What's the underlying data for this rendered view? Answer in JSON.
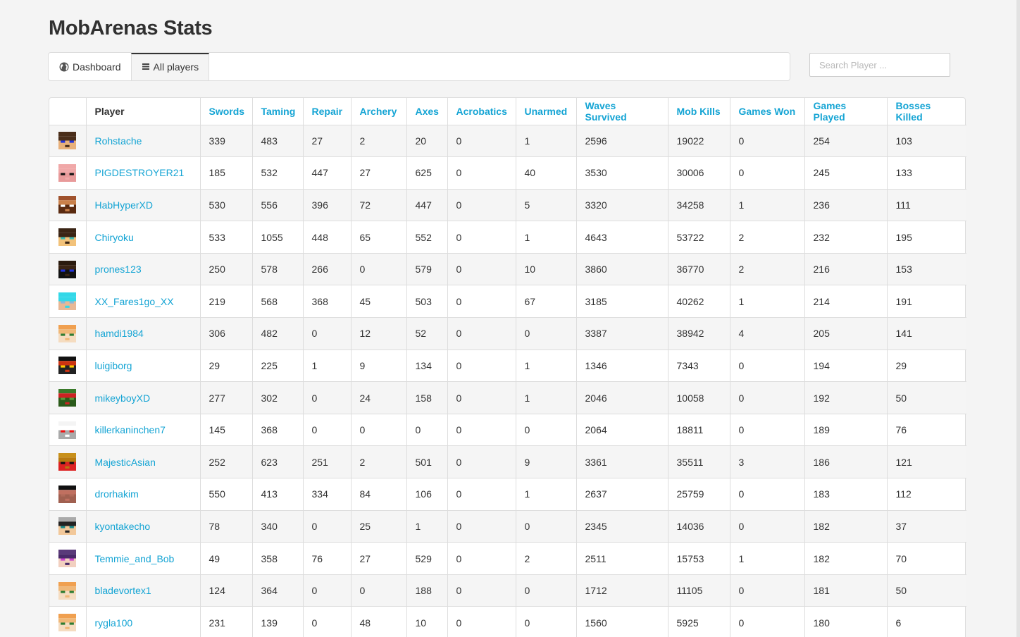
{
  "app": {
    "title": "MobArenas Stats"
  },
  "nav": {
    "items": [
      {
        "label": "Dashboard",
        "icon": "globe-icon",
        "active": false
      },
      {
        "label": "All players",
        "icon": "list-icon",
        "active": true
      }
    ]
  },
  "search": {
    "placeholder": "Search Player ...",
    "value": ""
  },
  "colors": {
    "accent": "#14a4d4",
    "text": "#333333",
    "background": "#f4f4f4",
    "stripe": "#f5f5f5"
  },
  "table": {
    "headers": [
      "",
      "Player",
      "Swords",
      "Taming",
      "Repair",
      "Archery",
      "Axes",
      "Acrobatics",
      "Unarmed",
      "Waves Survived",
      "Mob Kills",
      "Games Won",
      "Games Played",
      "Bosses Killed"
    ],
    "rows": [
      {
        "player": "Rohstache",
        "avatar": [
          "#4a2e1a",
          "#4a2e1a",
          "#2233dd",
          "#e8b07a"
        ],
        "stats": [
          "339",
          "483",
          "27",
          "2",
          "20",
          "0",
          "1",
          "2596",
          "19022",
          "0",
          "254",
          "103"
        ]
      },
      {
        "player": "PIGDESTROYER21",
        "avatar": [
          "#f0a8a8",
          "#f0a8a8",
          "#111111",
          "#e89a9a"
        ],
        "stats": [
          "185",
          "532",
          "447",
          "27",
          "625",
          "0",
          "40",
          "3530",
          "30006",
          "0",
          "245",
          "133"
        ]
      },
      {
        "player": "HabHyperXD",
        "avatar": [
          "#a0522d",
          "#c9804a",
          "#ffffff",
          "#5a2a10"
        ],
        "stats": [
          "530",
          "556",
          "396",
          "72",
          "447",
          "0",
          "5",
          "3320",
          "34258",
          "1",
          "236",
          "111"
        ]
      },
      {
        "player": "Chiryoku",
        "avatar": [
          "#3a2414",
          "#3a2414",
          "#3fb8b0",
          "#f2c27a"
        ],
        "stats": [
          "533",
          "1055",
          "448",
          "65",
          "552",
          "0",
          "1",
          "4643",
          "53722",
          "2",
          "232",
          "195"
        ]
      },
      {
        "player": "prones123",
        "avatar": [
          "#2a1a0e",
          "#3a2414",
          "#2233dd",
          "#111111"
        ],
        "stats": [
          "250",
          "578",
          "266",
          "0",
          "579",
          "0",
          "10",
          "3860",
          "36770",
          "2",
          "216",
          "153"
        ]
      },
      {
        "player": "XX_Fares1go_XX",
        "avatar": [
          "#33d8e8",
          "#33d8e8",
          "#8ab8d8",
          "#e8b895"
        ],
        "stats": [
          "219",
          "568",
          "368",
          "45",
          "503",
          "0",
          "67",
          "3185",
          "40262",
          "1",
          "214",
          "191"
        ]
      },
      {
        "player": "hamdi1984",
        "avatar": [
          "#f0a050",
          "#f0b878",
          "#2e7d32",
          "#f5dcc0"
        ],
        "stats": [
          "306",
          "482",
          "0",
          "12",
          "52",
          "0",
          "0",
          "3387",
          "38942",
          "4",
          "205",
          "141"
        ]
      },
      {
        "player": "luigiborg",
        "avatar": [
          "#111111",
          "#cc3311",
          "#ffcc00",
          "#222222"
        ],
        "stats": [
          "29",
          "225",
          "1",
          "9",
          "134",
          "0",
          "1",
          "1346",
          "7343",
          "0",
          "194",
          "29"
        ]
      },
      {
        "player": "mikeyboyXD",
        "avatar": [
          "#3a7a2a",
          "#cc2222",
          "#5a9a3a",
          "#2a5a1a"
        ],
        "stats": [
          "277",
          "302",
          "0",
          "24",
          "158",
          "0",
          "1",
          "2046",
          "10058",
          "0",
          "192",
          "50"
        ]
      },
      {
        "player": "killerkaninchen7",
        "avatar": [
          "#f4f4f4",
          "#ffffff",
          "#ee1111",
          "#aaaaaa"
        ],
        "stats": [
          "145",
          "368",
          "0",
          "0",
          "0",
          "0",
          "0",
          "2064",
          "18811",
          "0",
          "189",
          "76"
        ]
      },
      {
        "player": "MajesticAsian",
        "avatar": [
          "#c8901a",
          "#b87a10",
          "#111111",
          "#dd2222"
        ],
        "stats": [
          "252",
          "623",
          "251",
          "2",
          "501",
          "0",
          "9",
          "3361",
          "35511",
          "3",
          "186",
          "121"
        ]
      },
      {
        "player": "drorhakim",
        "avatar": [
          "#111111",
          "#c07060",
          "#b06a5a",
          "#a06050"
        ],
        "stats": [
          "550",
          "413",
          "334",
          "84",
          "106",
          "0",
          "1",
          "2637",
          "25759",
          "0",
          "183",
          "112"
        ]
      },
      {
        "player": "kyontakecho",
        "avatar": [
          "#aaaaaa",
          "#222222",
          "#1a8a8a",
          "#f2c89a"
        ],
        "stats": [
          "78",
          "340",
          "0",
          "25",
          "1",
          "0",
          "0",
          "2345",
          "14036",
          "0",
          "182",
          "37"
        ]
      },
      {
        "player": "Temmie_and_Bob",
        "avatar": [
          "#5a3a7a",
          "#4a2a6a",
          "#cc44cc",
          "#f2d0c0"
        ],
        "stats": [
          "49",
          "358",
          "76",
          "27",
          "529",
          "0",
          "2",
          "2511",
          "15753",
          "1",
          "182",
          "70"
        ]
      },
      {
        "player": "bladevortex1",
        "avatar": [
          "#f0a050",
          "#f0b878",
          "#2e7d32",
          "#f5dcc0"
        ],
        "stats": [
          "124",
          "364",
          "0",
          "0",
          "188",
          "0",
          "0",
          "1712",
          "11105",
          "0",
          "181",
          "50"
        ]
      },
      {
        "player": "rygla100",
        "avatar": [
          "#f0a050",
          "#f0b878",
          "#2e7d32",
          "#f5dcc0"
        ],
        "stats": [
          "231",
          "139",
          "0",
          "48",
          "10",
          "0",
          "0",
          "1560",
          "5925",
          "0",
          "180",
          "6"
        ]
      }
    ]
  }
}
